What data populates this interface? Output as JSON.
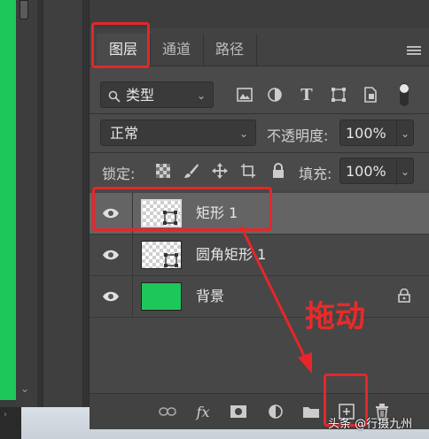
{
  "tabs": [
    {
      "label": "图层",
      "active": true
    },
    {
      "label": "通道",
      "active": false
    },
    {
      "label": "路径",
      "active": false
    }
  ],
  "filter": {
    "label": "类型",
    "icons": [
      "image-filter-icon",
      "adjustment-filter-icon",
      "text-filter-icon",
      "shape-filter-icon",
      "smart-object-filter-icon",
      "toggle-filter-icon"
    ]
  },
  "blend": {
    "mode": "正常",
    "opacity_label": "不透明度:",
    "opacity_value": "100%"
  },
  "lock": {
    "label": "锁定:",
    "fill_label": "填充:",
    "fill_value": "100%",
    "icons": [
      "lock-transparent-icon",
      "lock-pixels-icon",
      "lock-position-icon",
      "lock-artboard-icon",
      "lock-all-icon"
    ]
  },
  "layers": [
    {
      "name": "矩形 1",
      "selected": true,
      "thumb": "transparent-shape"
    },
    {
      "name": "圆角矩形 1",
      "selected": false,
      "thumb": "transparent-shape"
    },
    {
      "name": "背景",
      "selected": false,
      "thumb": "green-fill",
      "locked": true
    }
  ],
  "colors": {
    "background_fill": "#1ec75a",
    "annotation": "#e6262a"
  },
  "annotation": {
    "text": "拖动"
  },
  "footer_icons": [
    "link-layers-icon",
    "layer-style-icon",
    "add-mask-icon",
    "adjustment-layer-icon",
    "new-group-icon",
    "new-layer-icon",
    "delete-layer-icon"
  ],
  "footer": {
    "fx_label": "fx"
  },
  "watermark": "头条 @行摄九州"
}
